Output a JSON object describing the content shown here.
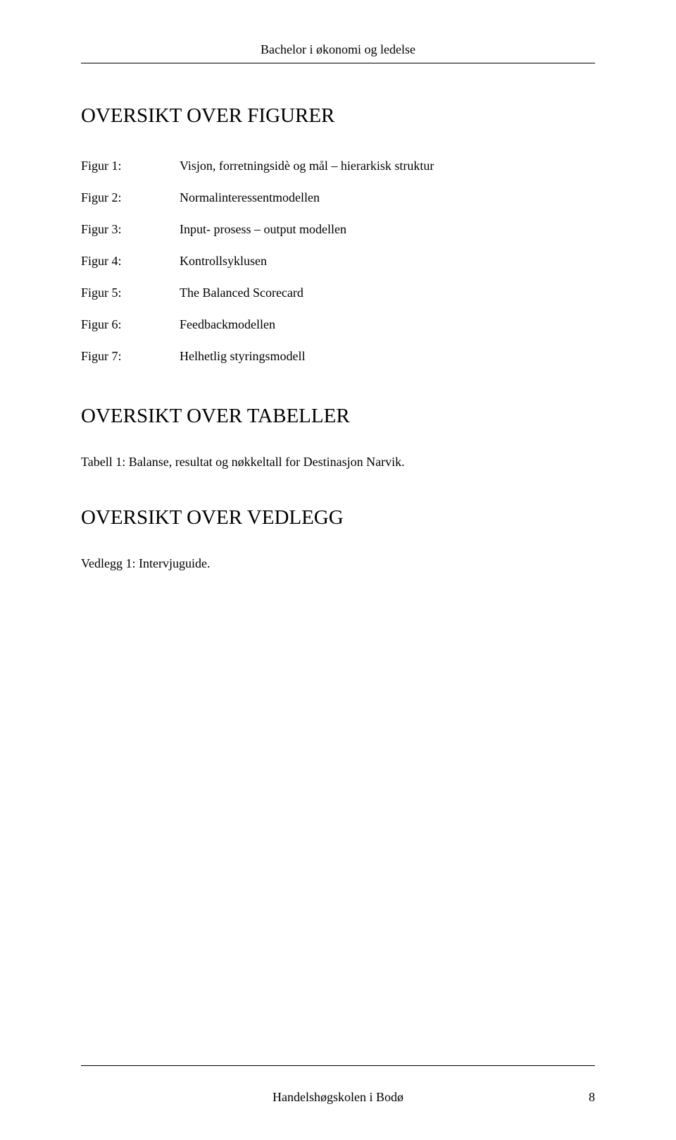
{
  "header": {
    "title": "Bachelor i økonomi og ledelse"
  },
  "sections": {
    "figures": {
      "heading": "OVERSIKT OVER FIGURER",
      "items": [
        {
          "label": "Figur 1:",
          "desc": "Visjon, forretningsidè og mål – hierarkisk struktur"
        },
        {
          "label": "Figur 2:",
          "desc": "Normalinteressentmodellen"
        },
        {
          "label": "Figur 3:",
          "desc": "Input- prosess – output modellen"
        },
        {
          "label": "Figur 4:",
          "desc": "Kontrollsyklusen"
        },
        {
          "label": "Figur 5:",
          "desc": "The Balanced Scorecard"
        },
        {
          "label": "Figur 6:",
          "desc": "Feedbackmodellen"
        },
        {
          "label": "Figur 7:",
          "desc": "Helhetlig styringsmodell"
        }
      ]
    },
    "tables": {
      "heading": "OVERSIKT OVER TABELLER",
      "text": "Tabell 1: Balanse, resultat og nøkkeltall for Destinasjon Narvik."
    },
    "appendix": {
      "heading": "OVERSIKT OVER VEDLEGG",
      "text": "Vedlegg 1: Intervjuguide."
    }
  },
  "footer": {
    "center": "Handelshøgskolen i Bodø",
    "page": "8"
  }
}
